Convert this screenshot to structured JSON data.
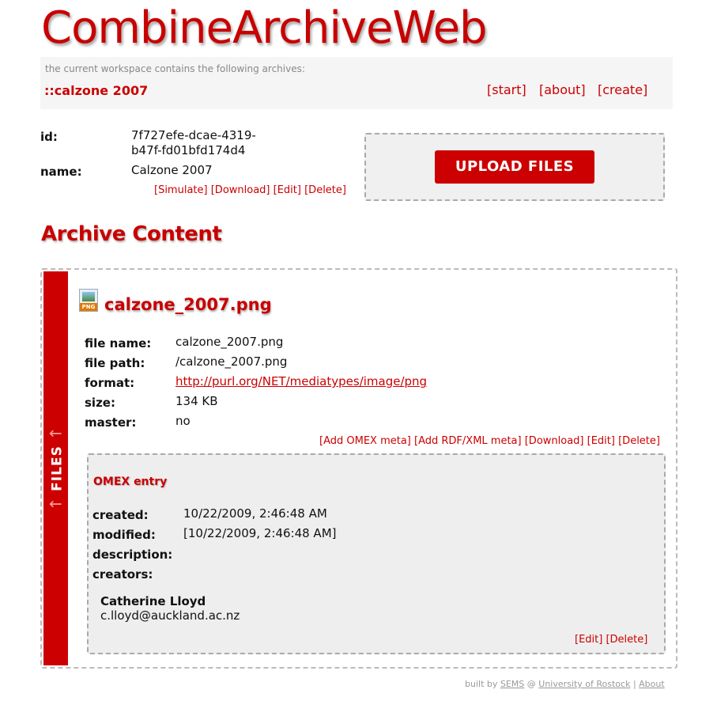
{
  "app": {
    "title": "CombineArchiveWeb"
  },
  "workspace": {
    "caption": "the current workspace contains the following archives:",
    "archive_link": "::calzone 2007",
    "nav": {
      "start": "[start]",
      "about": "[about]",
      "create": "[create]"
    }
  },
  "archive": {
    "id_label": "id:",
    "id_value_line1": "7f727efe-dcae-4319-",
    "id_value_line2": "b47f-fd01bfd174d4",
    "name_label": "name:",
    "name_value": "Calzone 2007",
    "actions": {
      "simulate": "[Simulate]",
      "download": "[Download]",
      "edit": "[Edit]",
      "delete": "[Delete]"
    }
  },
  "upload": {
    "button_label": "UPLOAD FILES"
  },
  "content": {
    "section_title": "Archive Content",
    "files_tab": {
      "arrow": "↑",
      "label": "FILES"
    },
    "file": {
      "icon": "png-file-icon",
      "icon_tag": "PNG",
      "title": "calzone_2007.png",
      "fields": {
        "file_name_label": "file name:",
        "file_name": "calzone_2007.png",
        "file_path_label": "file path:",
        "file_path": "/calzone_2007.png",
        "format_label": "format:",
        "format": "http://purl.org/NET/mediatypes/image/png",
        "size_label": "size:",
        "size": "134 KB",
        "master_label": "master:",
        "master": "no"
      },
      "actions": {
        "add_omex": "[Add OMEX meta]",
        "add_rdf": "[Add RDF/XML meta]",
        "download": "[Download]",
        "edit": "[Edit]",
        "delete": "[Delete]"
      }
    },
    "omex": {
      "title": "OMEX entry",
      "created_label": "created:",
      "created": "10/22/2009, 2:46:48 AM",
      "modified_label": "modified:",
      "modified": "[10/22/2009, 2:46:48 AM]",
      "description_label": "description:",
      "creators_label": "creators:",
      "creator_name": "Catherine Lloyd",
      "creator_email": "c.lloyd@auckland.ac.nz",
      "actions": {
        "edit": "[Edit]",
        "delete": "[Delete]"
      }
    }
  },
  "footer": {
    "built_by": "built by",
    "sems": "SEMS",
    "at": "@",
    "university": "University of Rostock",
    "separator": "|",
    "about": "About"
  },
  "colors": {
    "accent": "#cc0000",
    "panel_bg": "#eeeeee"
  }
}
